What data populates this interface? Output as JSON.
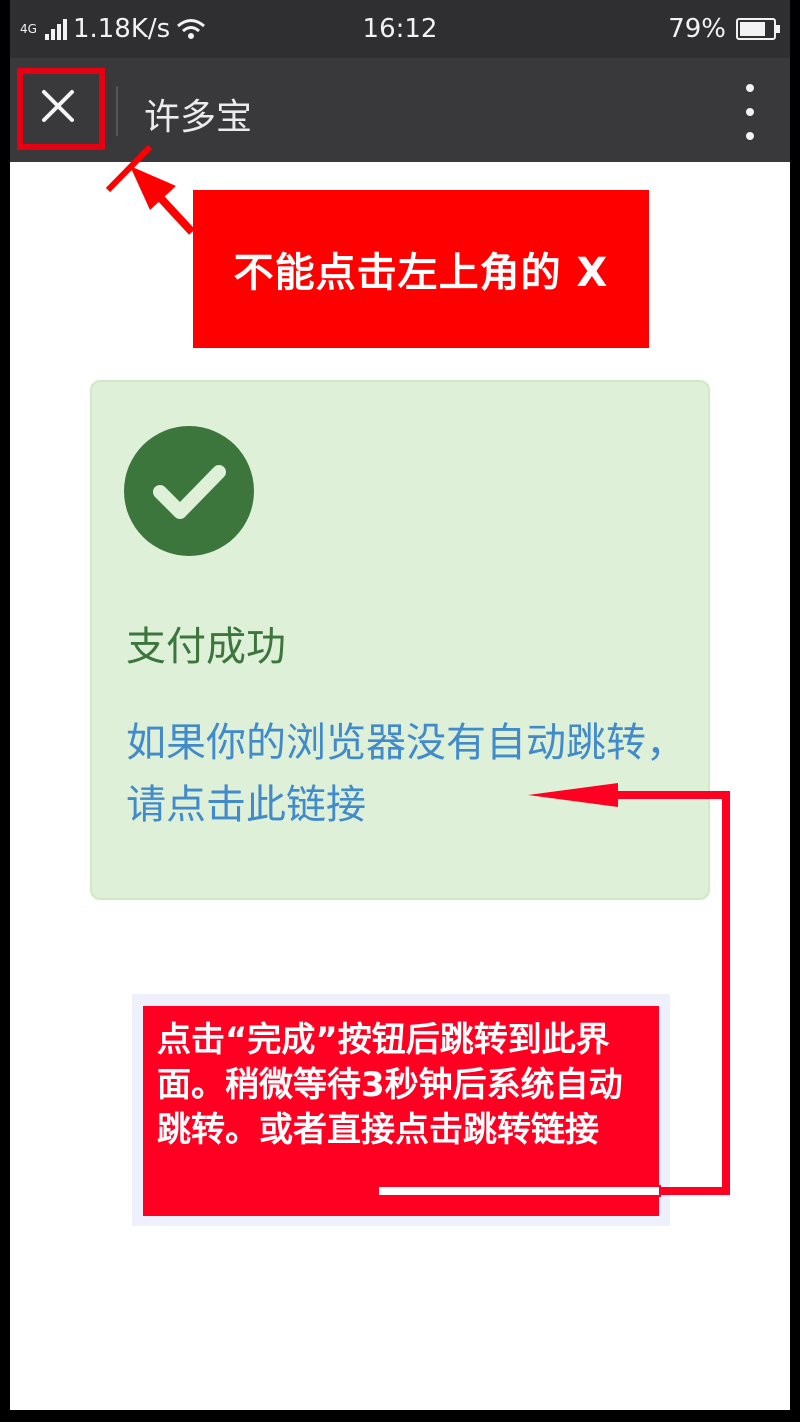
{
  "status_bar": {
    "network_type": "4G",
    "speed": "1.18K/s",
    "time": "16:12",
    "battery_percent": "79%",
    "battery_level": 0.79
  },
  "title_bar": {
    "title": "许多宝",
    "close_icon": "close-icon",
    "more_icon": "more-vertical-icon"
  },
  "annotations": {
    "top_note": "不能点击左上角的 X",
    "bottom_note": "点击“完成”按钮后跳转到此界面。稍微等待3秒钟后系统自动跳转。或者直接点击跳转链接",
    "highlight_color": "#e60012"
  },
  "card": {
    "status_icon": "check-circle-icon",
    "title": "支付成功",
    "link_text": "如果你的浏览器没有自动跳转，请点击此链接",
    "bg_color": "#dff0d8",
    "title_color": "#3c763d",
    "link_color": "#428bca"
  }
}
